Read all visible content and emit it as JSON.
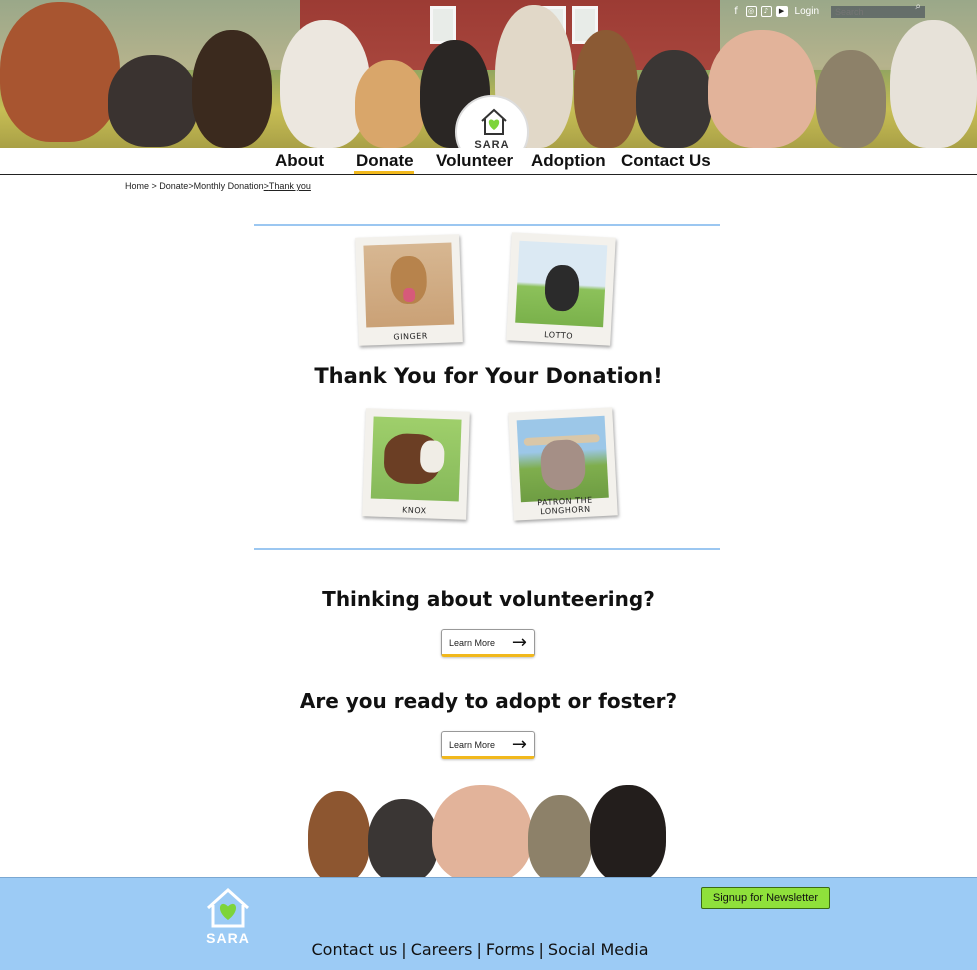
{
  "header": {
    "social": [
      "f",
      "ig",
      "tt",
      "yt"
    ],
    "login_label": "Login",
    "search_placeholder": "Search",
    "logo_text": "SARA"
  },
  "nav": {
    "items": [
      "About",
      "Donate",
      "Volunteer",
      "Adoption",
      "Contact Us"
    ],
    "active": "Donate"
  },
  "breadcrumb": {
    "home": "Home",
    "sep1": " > ",
    "donate": "Donate",
    "sep2": ">",
    "monthly": "Monthly Donation",
    "sep3": ">",
    "current": "Thank you"
  },
  "polaroids": [
    {
      "caption": "GINGER"
    },
    {
      "caption": "LOTTO"
    },
    {
      "caption": "KNOX"
    },
    {
      "caption": "PATRON THE LONGHORN"
    }
  ],
  "thanks_heading": "Thank You for Your Donation!",
  "volunteer": {
    "heading": "Thinking about volunteering?",
    "button": "Learn More"
  },
  "adopt": {
    "heading": "Are you ready to adopt or foster?",
    "button": "Learn More"
  },
  "footer": {
    "logo_text": "SARA",
    "newsletter": "Signup for Newsletter",
    "links": [
      "Contact us",
      "Careers",
      "Forms",
      "Social Media"
    ],
    "separator": "|"
  },
  "colors": {
    "accent": "#f1b81c",
    "divider": "#9bc7f1",
    "footer_bg": "#9ccbf5",
    "newsletter_bg": "#8fe13b",
    "logo_green": "#7dd43a"
  },
  "icons": [
    "facebook-icon",
    "instagram-icon",
    "tiktok-icon",
    "youtube-icon",
    "search-icon",
    "house-heart-logo-icon",
    "right-arrow-icon"
  ]
}
